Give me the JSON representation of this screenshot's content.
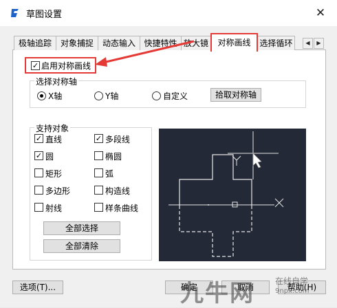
{
  "window": {
    "title": "草图设置",
    "close_glyph": "✕"
  },
  "tabs": [
    {
      "label": "极轴追踪"
    },
    {
      "label": "对象捕捉"
    },
    {
      "label": "动态输入"
    },
    {
      "label": "快捷特性"
    },
    {
      "label": "放大镜"
    },
    {
      "label": "对称画线"
    },
    {
      "label": "选择循环"
    }
  ],
  "tab_scroll": {
    "left": "◀",
    "right": "▶"
  },
  "enable_symmetry": {
    "label": "启用对称画线",
    "checked": true,
    "check_glyph": "✓"
  },
  "axis_group": {
    "title": "选择对称轴",
    "options": [
      {
        "label": "X轴",
        "selected": true
      },
      {
        "label": "Y轴",
        "selected": false
      },
      {
        "label": "自定义",
        "selected": false
      }
    ],
    "pick_button": "拾取对称轴"
  },
  "objects_group": {
    "title": "支持对象",
    "items": [
      {
        "label": "直线",
        "checked": true
      },
      {
        "label": "多段线",
        "checked": true
      },
      {
        "label": "圆",
        "checked": true
      },
      {
        "label": "椭圆",
        "checked": false
      },
      {
        "label": "矩形",
        "checked": false
      },
      {
        "label": "弧",
        "checked": false
      },
      {
        "label": "多边形",
        "checked": false
      },
      {
        "label": "构造线",
        "checked": false
      },
      {
        "label": "射线",
        "checked": false
      },
      {
        "label": "样条曲线",
        "checked": false
      }
    ],
    "select_all": "全部选择",
    "clear_all": "全部清除"
  },
  "footer": {
    "options_button": "选项(T)...",
    "ok_button": "确定",
    "cancel_button": "取消",
    "help_button": "帮助(H)"
  },
  "watermark": {
    "main": "九牛网",
    "sub1": "在线自学",
    "sub2": "9npx.com"
  },
  "colors": {
    "accent_red": "#e53935",
    "preview_bg": "#232936"
  }
}
